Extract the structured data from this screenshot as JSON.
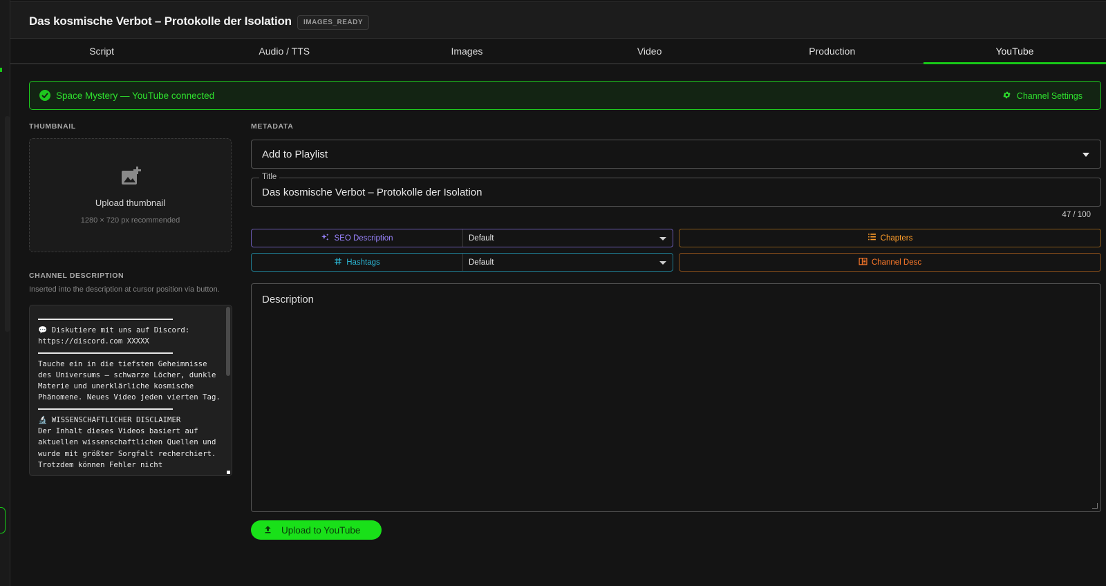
{
  "header": {
    "title": "Das kosmische Verbot – Protokolle der Isolation",
    "status_badge": "IMAGES_READY"
  },
  "tabs": [
    {
      "label": "Script"
    },
    {
      "label": "Audio / TTS"
    },
    {
      "label": "Images"
    },
    {
      "label": "Video"
    },
    {
      "label": "Production"
    },
    {
      "label": "YouTube",
      "active": true
    }
  ],
  "banner": {
    "message": "Space Mystery — YouTube connected",
    "settings_label": "Channel Settings"
  },
  "thumbnail": {
    "section_label": "THUMBNAIL",
    "upload_label": "Upload thumbnail",
    "hint": "1280 × 720 px recommended"
  },
  "channel_description": {
    "section_label": "CHANNEL DESCRIPTION",
    "hint": "Inserted into the description at cursor position via button.",
    "block_1": "💬 Diskutiere mit uns auf Discord:\nhttps://discord.com XXXXX",
    "block_2": "Tauche ein in die tiefsten Geheimnisse des Universums – schwarze Löcher, dunkle Materie und unerklärliche kosmische Phänomene. Neues Video jeden vierten Tag.",
    "block_3": "🔬 WISSENSCHAFTLICHER DISCLAIMER\nDer Inhalt dieses Videos basiert auf aktuellen wissenschaftlichen Quellen und wurde mit größter Sorgfalt recherchiert. Trotzdem können Fehler nicht"
  },
  "metadata": {
    "section_label": "METADATA",
    "playlist_value": "Add to Playlist",
    "title_label": "Title",
    "title_value": "Das kosmische Verbot – Protokolle der Isolation",
    "title_counter": "47 / 100",
    "seo_button": "SEO Description",
    "seo_select": "Default",
    "hashtags_button": "Hashtags",
    "hashtags_select": "Default",
    "chapters_button": "Chapters",
    "channel_desc_button": "Channel Desc",
    "description_placeholder": "Description",
    "upload_button": "Upload to YouTube"
  },
  "colors": {
    "accent": "#19e019",
    "seo": "#9a84ff",
    "hashtags": "#2ab3d1",
    "chapters": "#ff9d2a",
    "channel_desc": "#ff7a2a"
  },
  "icons": [
    "check-circle-icon",
    "gear-icon",
    "add-photo-icon",
    "sparkles-icon",
    "hashtag-icon",
    "list-icon",
    "book-icon",
    "upload-icon"
  ]
}
